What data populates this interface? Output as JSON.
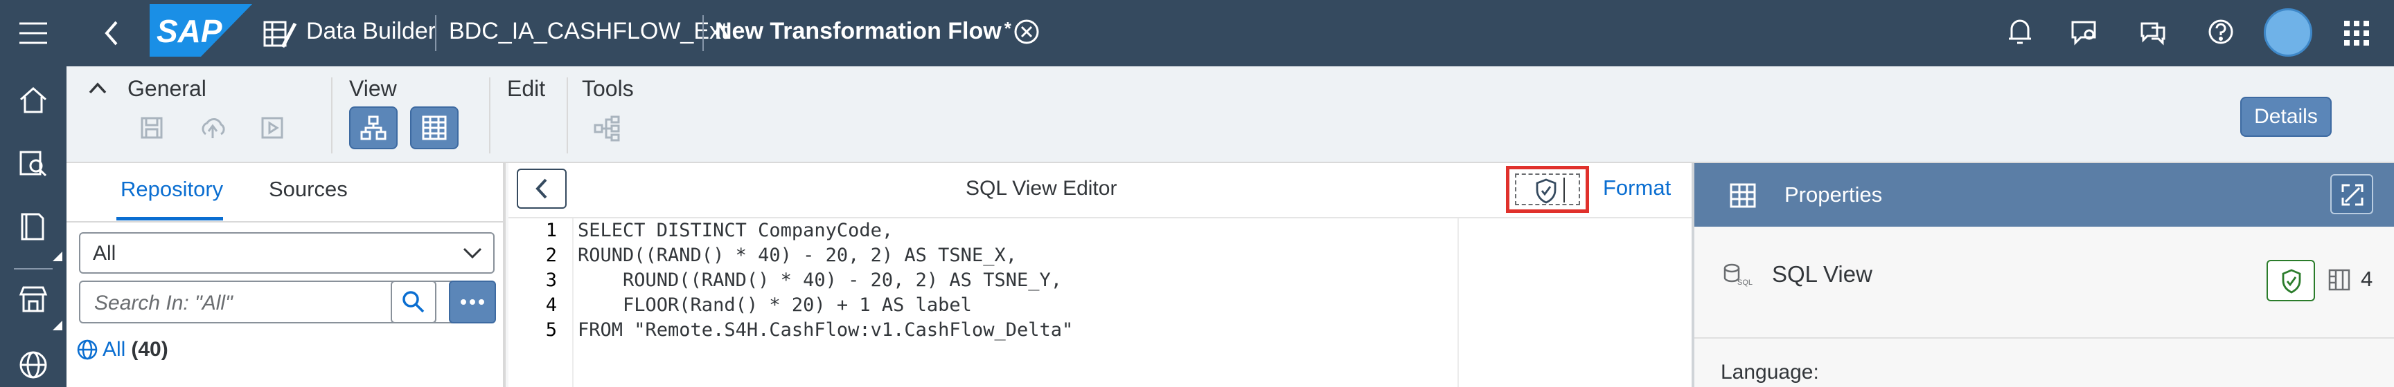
{
  "shell": {
    "logo": "SAP",
    "app_name": "Data Builder",
    "space_name": "BDC_IA_CASHFLOW_Ext",
    "flow_title": "New Transformation Flow",
    "unsaved_marker": "*"
  },
  "toolbar": {
    "general_label": "General",
    "view_label": "View",
    "edit_label": "Edit",
    "tools_label": "Tools",
    "details_label": "Details"
  },
  "left_panel": {
    "tabs": [
      "Repository",
      "Sources"
    ],
    "active_tab": "Repository",
    "filter_value": "All",
    "search_placeholder": "Search In: \"All\"",
    "tree_item_label": "All",
    "tree_item_count": "(40)"
  },
  "editor": {
    "title": "SQL View Editor",
    "format_label": "Format",
    "line_numbers": [
      "1",
      "2",
      "3",
      "4",
      "5"
    ],
    "code_lines": [
      "SELECT DISTINCT CompanyCode,",
      "ROUND((RAND() * 40) - 20, 2) AS TSNE_X,",
      "    ROUND((RAND() * 40) - 20, 2) AS TSNE_Y,",
      "    FLOOR(Rand() * 20) + 1 AS label",
      "FROM \"Remote.S4H.CashFlow:v1.CashFlow_Delta\""
    ]
  },
  "properties": {
    "header": "Properties",
    "object_type": "SQL View",
    "column_count": "4",
    "language_label": "Language:"
  },
  "colors": {
    "shell_bg": "#354a5f",
    "accent": "#0a6ed1",
    "highlight_box": "#e0312c",
    "properties_header_bg": "#5b7ea6"
  }
}
